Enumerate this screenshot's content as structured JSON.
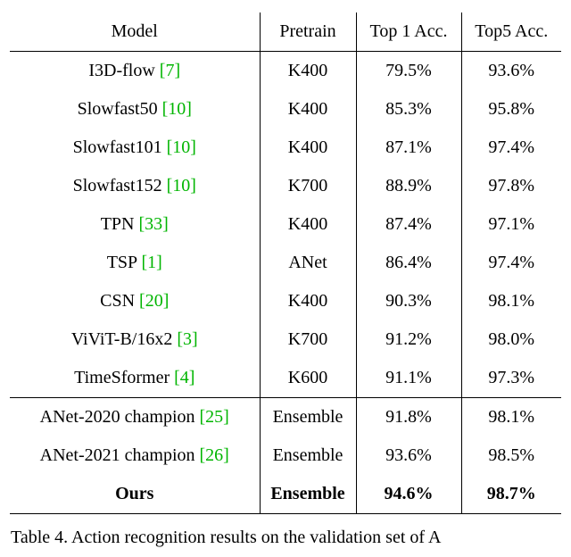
{
  "table": {
    "headers": [
      "Model",
      "Pretrain",
      "Top 1 Acc.",
      "Top5 Acc."
    ],
    "rows_main": [
      {
        "model": "I3D-flow",
        "cite": "[7]",
        "pretrain": "K400",
        "top1": "79.5%",
        "top5": "93.6%"
      },
      {
        "model": "Slowfast50",
        "cite": "[10]",
        "pretrain": "K400",
        "top1": "85.3%",
        "top5": "95.8%"
      },
      {
        "model": "Slowfast101",
        "cite": "[10]",
        "pretrain": "K400",
        "top1": "87.1%",
        "top5": "97.4%"
      },
      {
        "model": "Slowfast152",
        "cite": "[10]",
        "pretrain": "K700",
        "top1": "88.9%",
        "top5": "97.8%"
      },
      {
        "model": "TPN",
        "cite": "[33]",
        "pretrain": "K400",
        "top1": "87.4%",
        "top5": "97.1%"
      },
      {
        "model": "TSP",
        "cite": "[1]",
        "pretrain": "ANet",
        "top1": "86.4%",
        "top5": "97.4%"
      },
      {
        "model": "CSN",
        "cite": "[20]",
        "pretrain": "K400",
        "top1": "90.3%",
        "top5": "98.1%"
      },
      {
        "model": "ViViT-B/16x2",
        "cite": "[3]",
        "pretrain": "K700",
        "top1": "91.2%",
        "top5": "98.0%"
      },
      {
        "model": "TimeSformer",
        "cite": "[4]",
        "pretrain": "K600",
        "top1": "91.1%",
        "top5": "97.3%"
      }
    ],
    "rows_ensemble": [
      {
        "model": "ANet-2020 champion",
        "cite": "[25]",
        "pretrain": "Ensemble",
        "top1": "91.8%",
        "top5": "98.1%"
      },
      {
        "model": "ANet-2021 champion",
        "cite": "[26]",
        "pretrain": "Ensemble",
        "top1": "93.6%",
        "top5": "98.5%"
      }
    ],
    "row_ours": {
      "model": "Ours",
      "pretrain": "Ensemble",
      "top1": "94.6%",
      "top5": "98.7%"
    }
  },
  "caption_fragment": "Table 4. Action recognition results on the validation set of A"
}
